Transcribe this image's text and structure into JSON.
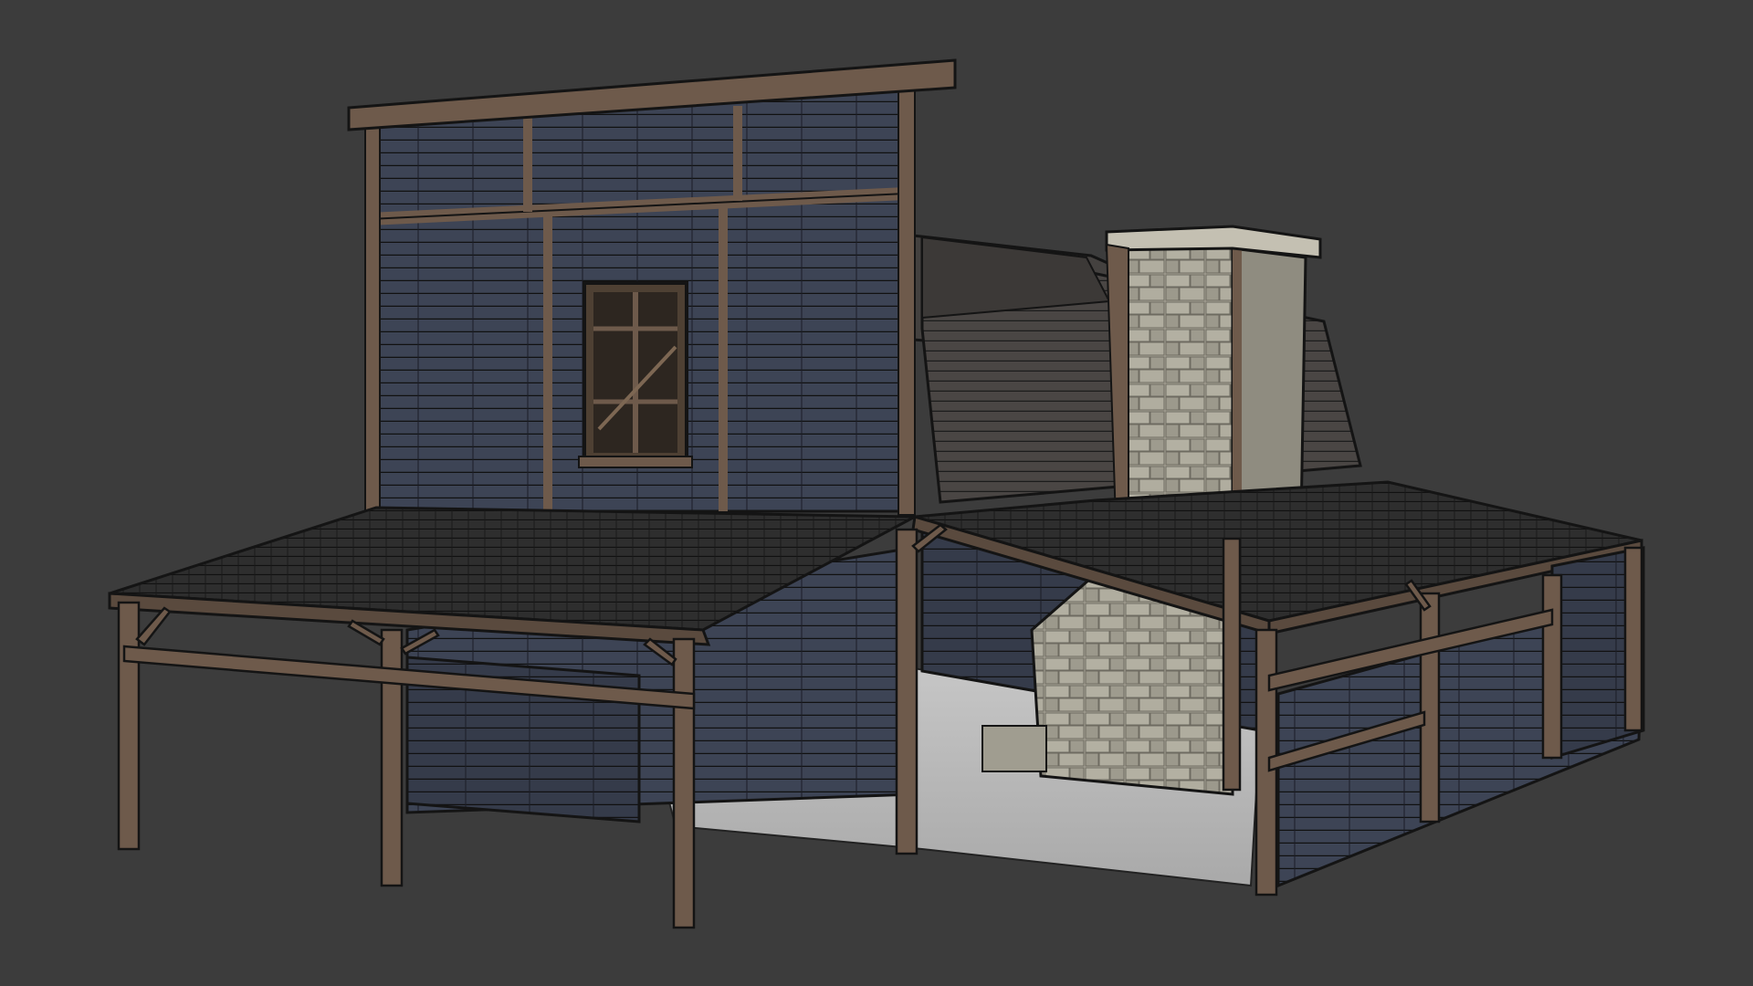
{
  "scene": {
    "subject": "",
    "background_color": "#3c3c3c",
    "colors": {
      "siding": "#3d4455",
      "siding_dark": "#2c3140",
      "timber": "#6e5a4b",
      "timber_dark": "#4a3d33",
      "roof": "#2f2f2f",
      "roof_line": "#1a1a1a",
      "upper_roof": "#4a4644",
      "stone": "#a8a598",
      "stone_dark": "#7b786d",
      "floor": "#b9b9b9",
      "outline": "#141414"
    }
  }
}
